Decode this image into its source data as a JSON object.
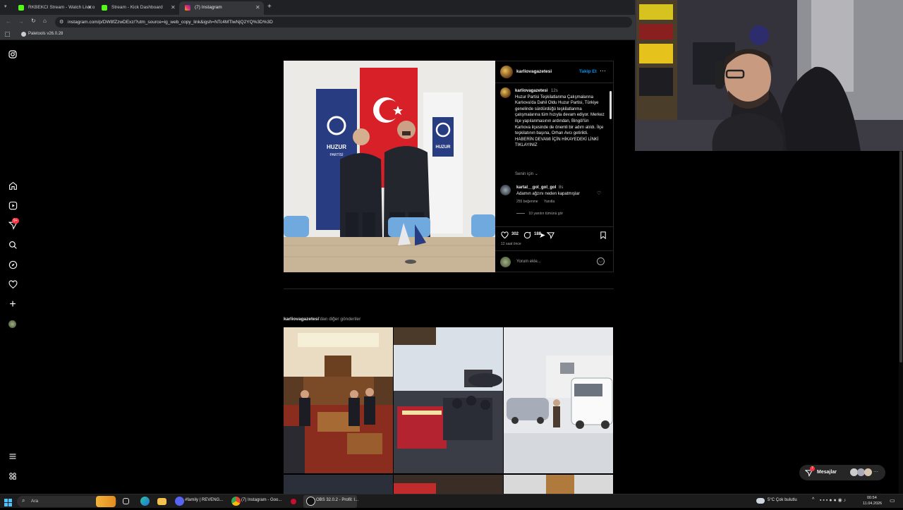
{
  "browser": {
    "tabs": [
      {
        "label": "RKBEKCI Stream - Watch Live o",
        "active": false,
        "favicon_color": "#53fc18"
      },
      {
        "label": "Stream - Kick Dashboard",
        "active": false,
        "favicon_color": "#53fc18"
      },
      {
        "label": "(7) Instagram",
        "active": true,
        "favicon_color": "#e1306c"
      }
    ],
    "url": "instagram.com/p/DW8fZzwDExz/?utm_source=ig_web_copy_link&igsh=NTc4MTlwNjQ2YQ%3D%3D",
    "bookmark": "Paletools v26.0.28"
  },
  "instagram": {
    "nav_badge": "9+",
    "post": {
      "author": "karliovagazetesi",
      "follow_label": "Takip Et",
      "caption_time": "12s",
      "caption": "Huzur Partisi Teşkilatlanma Çalışmalarına Karlıova'da Dahil Oldu Huzur Partisi, Türkiye genelinde sürdürdüğü teşkilatlanma çalışmalarına tüm hızıyla devam ediyor. Merkez ilçe yapılanmasının ardından, Bingöl'ün Karlıova ilçesinde de önemli bir adım atıldı. İlçe teşkilatının başına, Orhan Avcı getirildi.",
      "caption_cta": "HABERİN DEVAMI İÇİN HİKAYEDEKİ LİNKİ TIKLAYINIZ",
      "for_you": "Senin için",
      "comment": {
        "user": "kartal__gol_gol_gol",
        "time": "8s",
        "text": "Adamın ağzını neden kapatmışlar",
        "likes": "255 beğenme",
        "reply": "Yanıtla",
        "view_replies": "10 yanıtın tümünü gör"
      },
      "like_count": "302",
      "comment_count": "188",
      "time_ago": "12 saat önce",
      "comment_placeholder": "Yorum ekle..."
    },
    "more_posts_user": "karliovagazetesi",
    "more_posts_suffix": "'dan diğer gönderiler",
    "messages_label": "Mesajlar",
    "messages_badge": "7"
  },
  "taskbar": {
    "search": "Ara",
    "apps": [
      {
        "label": "#family | REVENG..."
      },
      {
        "label": "(7) Instagram - Goo..."
      },
      {
        "label": "OBS 32.0.2 - Profil: I..."
      }
    ],
    "weather": "5°C  Çok bulutlu",
    "time": "00:54",
    "date": "11.04.2026"
  }
}
